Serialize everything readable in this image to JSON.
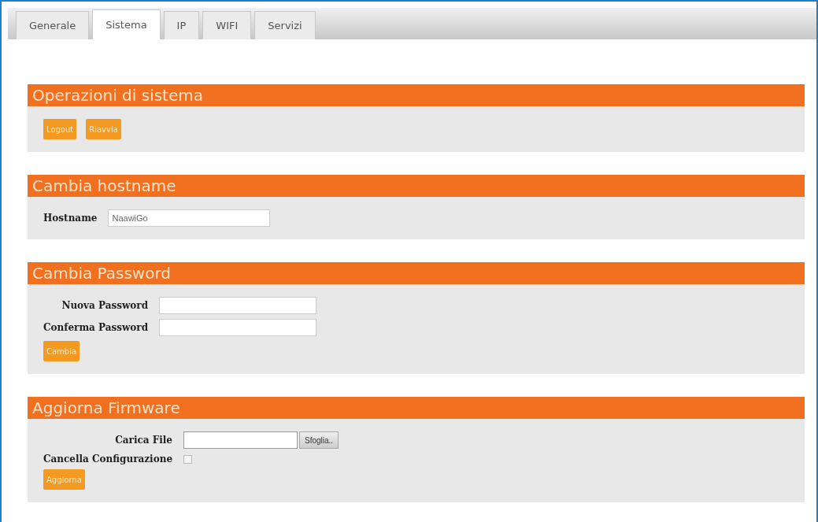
{
  "tabs": [
    {
      "label": "Generale",
      "selected": false
    },
    {
      "label": "Sistema",
      "selected": true
    },
    {
      "label": "IP",
      "selected": false
    },
    {
      "label": "WIFI",
      "selected": false
    },
    {
      "label": "Servizi",
      "selected": false
    }
  ],
  "sections": [
    {
      "title": "Operazioni di sistema",
      "buttons": [
        "Logout",
        "Riavvia"
      ]
    },
    {
      "title": "Cambia hostname",
      "fields": [
        {
          "kind": "text",
          "label": "Hostname",
          "value": "NaawiGo"
        }
      ]
    },
    {
      "title": "Cambia Password",
      "fields": [
        {
          "kind": "text",
          "label": "Nuova Password"
        },
        {
          "kind": "text",
          "label": "Conferma Password"
        }
      ],
      "buttons": [
        "Cambia"
      ]
    },
    {
      "title": "Aggiorna Firmware",
      "fields": [
        {
          "kind": "file",
          "label": "Carica File",
          "button": "Sfoglia.."
        },
        {
          "kind": "checkbox",
          "label": "Cancella Configurazione",
          "checked": false
        }
      ],
      "buttons": [
        "Aggiorna"
      ]
    }
  ]
}
